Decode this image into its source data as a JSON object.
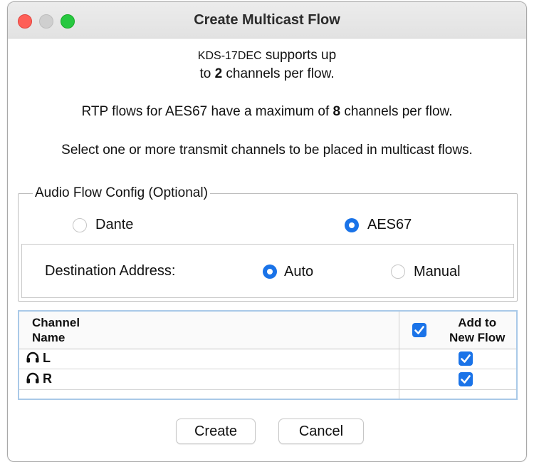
{
  "window": {
    "title": "Create Multicast Flow"
  },
  "info": {
    "device": "KDS-17DEC",
    "line1_rest": " supports up",
    "line2_pre": "to ",
    "line2_num": "2",
    "line2_post": " channels per flow.",
    "rtp_pre": "RTP flows for AES67 have a maximum of ",
    "rtp_num": "8",
    "rtp_post": " channels per flow.",
    "instruction": "Select one or more transmit channels to be placed in multicast flows."
  },
  "audio_flow_config": {
    "legend": "Audio Flow Config (Optional)",
    "options": [
      {
        "label": "Dante",
        "selected": false
      },
      {
        "label": "AES67",
        "selected": true
      }
    ],
    "destination": {
      "label": "Destination Address:",
      "options": [
        {
          "label": "Auto",
          "selected": true
        },
        {
          "label": "Manual",
          "selected": false
        }
      ]
    }
  },
  "table": {
    "col_channel_line1": "Channel",
    "col_channel_line2": "Name",
    "col_add_line1": "Add to",
    "col_add_line2": "New Flow",
    "select_all_checked": true,
    "rows": [
      {
        "icon": "headphones-icon",
        "name": "L",
        "checked": true
      },
      {
        "icon": "headphones-icon",
        "name": "R",
        "checked": true
      }
    ]
  },
  "buttons": {
    "create": "Create",
    "cancel": "Cancel"
  },
  "colors": {
    "accent": "#1a73e8",
    "close": "#fe5f57",
    "maximize": "#27c840",
    "minimize": "#cfcfcf"
  }
}
